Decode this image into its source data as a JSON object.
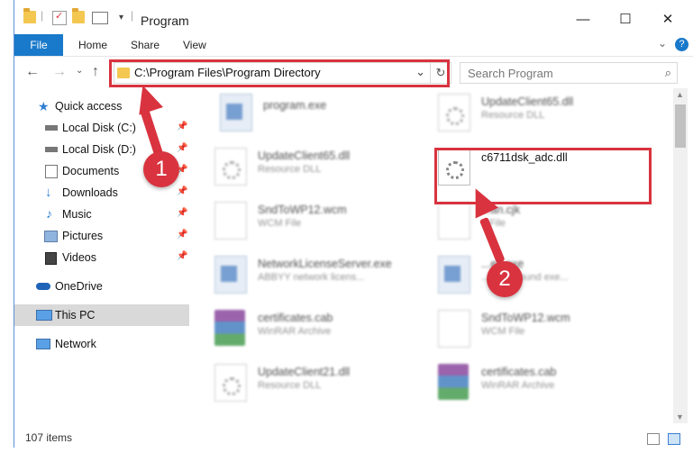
{
  "window": {
    "title": "Program",
    "controls": {
      "minimize": "—",
      "maximize": "☐",
      "close": "✕"
    }
  },
  "ribbon": {
    "file_tab": "File",
    "tabs": [
      "Home",
      "Share",
      "View"
    ],
    "help": "?"
  },
  "navigation": {
    "address_path": "C:\\Program Files\\Program Directory",
    "search_placeholder": "Search Program"
  },
  "sidebar": {
    "items": [
      {
        "label": "Quick access",
        "icon": "star-icon"
      },
      {
        "label": "Local Disk (C:)",
        "icon": "drive-icon",
        "pinned": true
      },
      {
        "label": "Local Disk (D:)",
        "icon": "drive-icon",
        "pinned": true
      },
      {
        "label": "Documents",
        "icon": "documents-icon",
        "pinned": true
      },
      {
        "label": "Downloads",
        "icon": "download-icon",
        "pinned": true
      },
      {
        "label": "Music",
        "icon": "music-icon",
        "pinned": true
      },
      {
        "label": "Pictures",
        "icon": "pictures-icon",
        "pinned": true
      },
      {
        "label": "Videos",
        "icon": "videos-icon",
        "pinned": true
      },
      {
        "label": "OneDrive",
        "icon": "cloud-icon"
      },
      {
        "label": "This PC",
        "icon": "computer-icon",
        "selected": true
      },
      {
        "label": "Network",
        "icon": "network-icon"
      }
    ]
  },
  "files": {
    "left": [
      {
        "name": "program.exe",
        "type": ""
      },
      {
        "name": "UpdateClient65.dll",
        "type": "Resource DLL"
      },
      {
        "name": "SndToWP12.wcm",
        "type": "WCM File"
      },
      {
        "name": "NetworkLicenseServer.exe",
        "type": "ABBYY network licens..."
      },
      {
        "name": "certificates.cab",
        "type": "WinRAR Archive"
      },
      {
        "name": "UpdateClient21.dll",
        "type": "Resource DLL"
      }
    ],
    "right": [
      {
        "name": "UpdateClient65.dll",
        "type": "Resource DLL"
      },
      {
        "name": "c6711dsk_adc.dll",
        "type": ""
      },
      {
        "name": "...an.cjk",
        "type": "...File"
      },
      {
        "name": "...ec.exe",
        "type": "...background exe..."
      },
      {
        "name": "SndToWP12.wcm",
        "type": "WCM File"
      },
      {
        "name": "certificates.cab",
        "type": "WinRAR Archive"
      }
    ]
  },
  "status": {
    "item_count": "107 items"
  },
  "callouts": {
    "step1": "1",
    "step2": "2"
  },
  "colors": {
    "accent": "#1979ca",
    "highlight": "#d9333f",
    "selected_bg": "#d9d9d9"
  }
}
